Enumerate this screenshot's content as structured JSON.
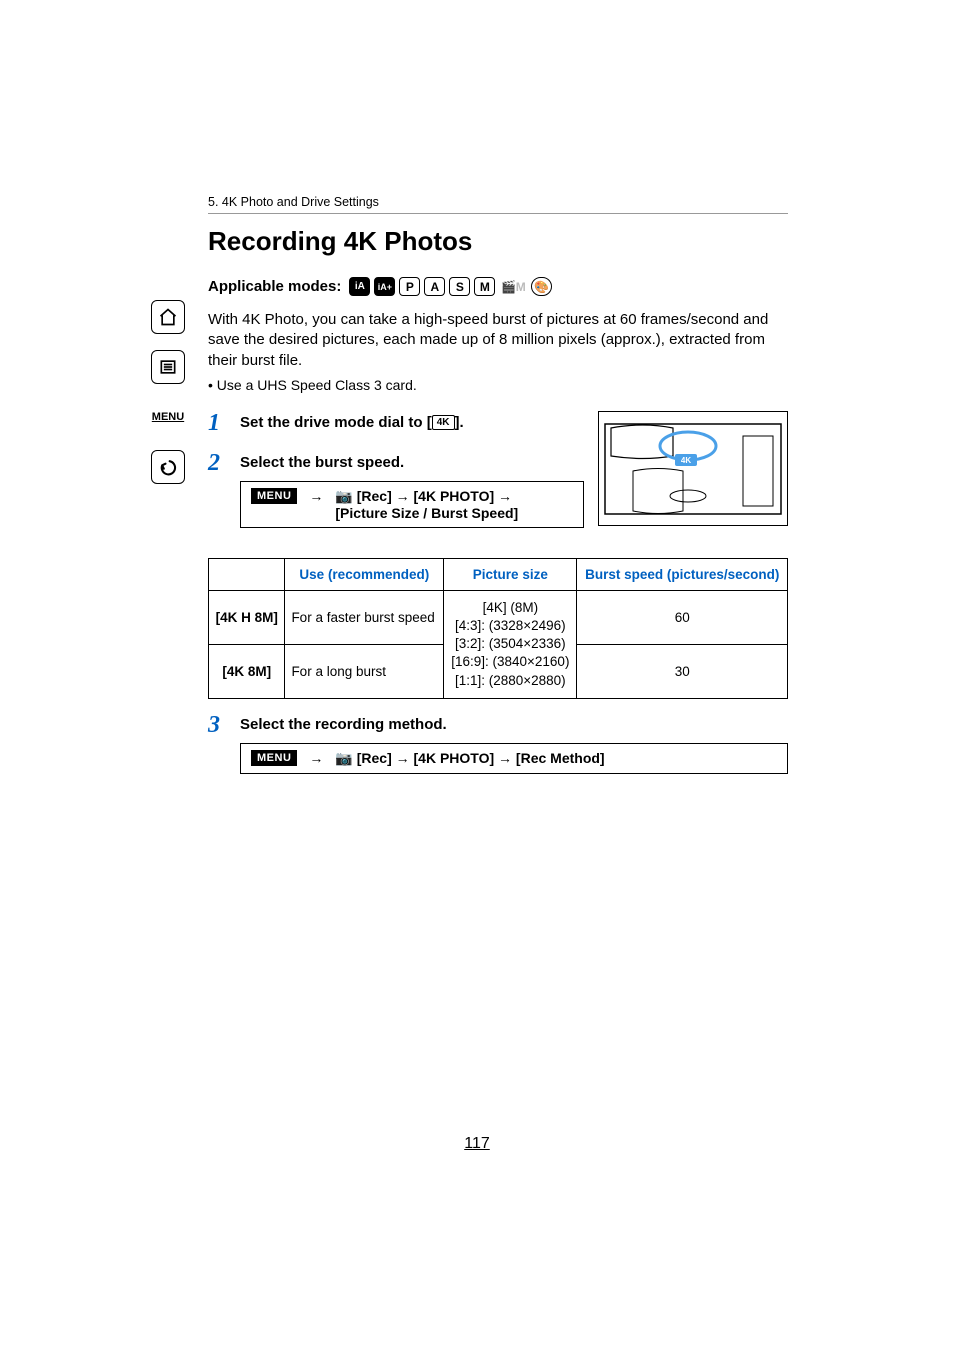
{
  "breadcrumb": "5. 4K Photo and Drive Settings",
  "title": "Recording 4K Photos",
  "modes_label": "Applicable modes:",
  "modes": {
    "ia1": "iA",
    "ia2": "iA+",
    "p": "P",
    "a": "A",
    "s": "S",
    "m": "M",
    "dim": "🎬M",
    "palette": "🎨"
  },
  "intro": "With 4K Photo, you can take a high-speed burst of pictures at 60 frames/second and save the desired pictures, each made up of 8 million pixels (approx.), extracted from their burst file.",
  "bullet": "• Use a UHS Speed Class 3 card.",
  "menu_badge": "MENU",
  "steps": {
    "s1": {
      "num": "1",
      "title_pre": "Set the drive mode dial to [",
      "title_post": "].",
      "icon": "4K"
    },
    "s2": {
      "num": "2",
      "title": "Select the burst speed.",
      "menu_line1": "[Rec] → [4K PHOTO] →",
      "menu_line2": "[Picture Size / Burst Speed]"
    },
    "s3": {
      "num": "3",
      "title": "Select the recording method.",
      "menu_line": "[Rec] → [4K PHOTO] → [Rec Method]"
    }
  },
  "table": {
    "headers": {
      "c1": "",
      "c2": "Use (recommended)",
      "c3": "Picture size",
      "c4": "Burst speed (pictures/second)"
    },
    "picsize": {
      "l1": "[4K] (8M)",
      "l2": "[4:3]: (3328×2496)",
      "l3": "[3:2]: (3504×2336)",
      "l4": "[16:9]: (3840×2160)",
      "l5": "[1:1]: (2880×2880)"
    },
    "rows": [
      {
        "label": "[4K H 8M]",
        "use": "For a faster burst speed",
        "burst": "60"
      },
      {
        "label": "[4K 8M]",
        "use": "For a long burst",
        "burst": "30"
      }
    ]
  },
  "page_number": "117"
}
